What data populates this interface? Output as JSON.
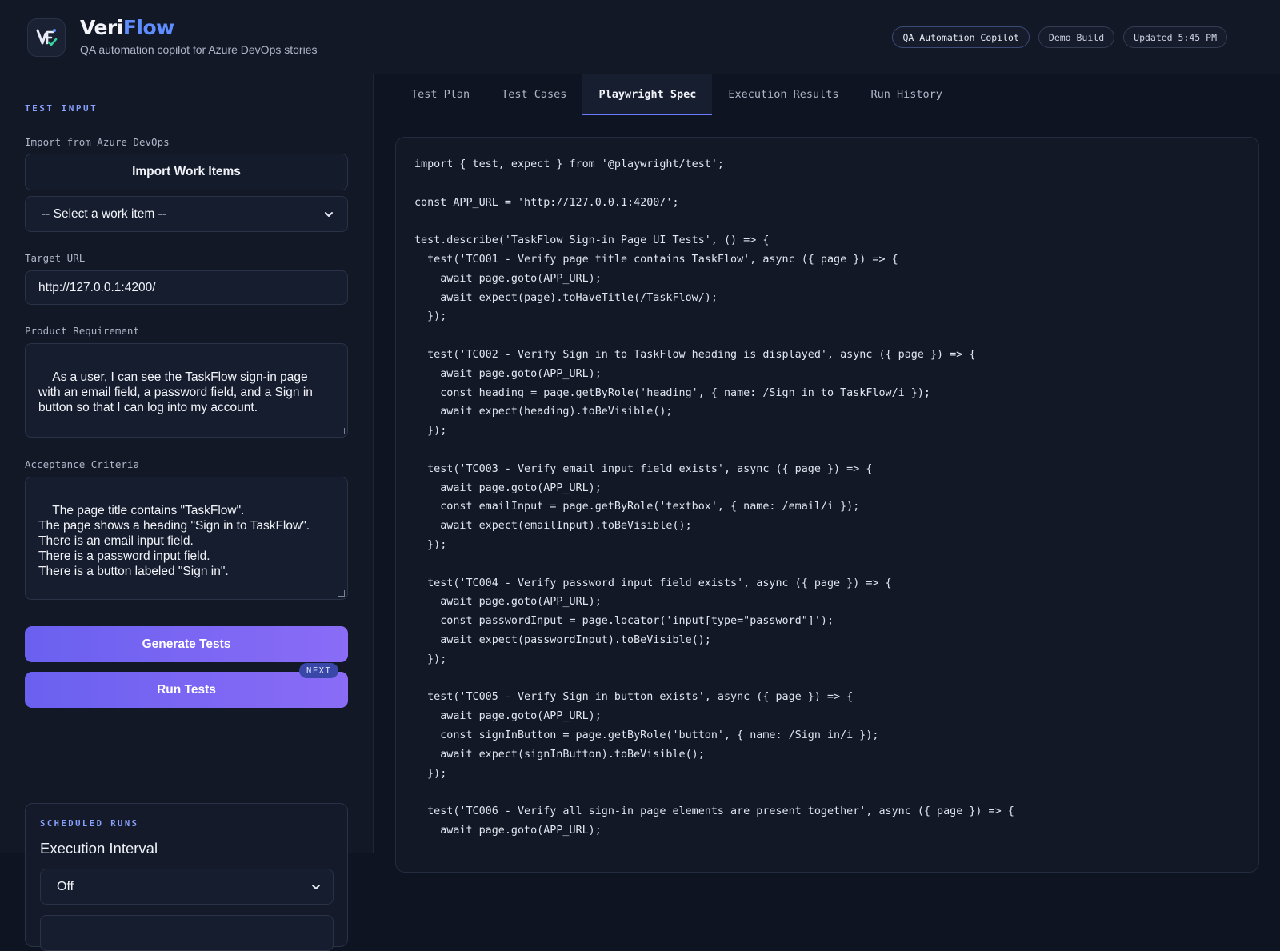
{
  "header": {
    "brand_prefix": "Veri",
    "brand_suffix": "Flow",
    "subtitle": "QA automation copilot for Azure DevOps stories",
    "badges": [
      "QA Automation Copilot",
      "Demo Build",
      "Updated 5:45 PM"
    ]
  },
  "sidebar": {
    "section_title": "TEST INPUT",
    "import_label": "Import from Azure DevOps",
    "import_button": "Import Work Items",
    "work_item_select": "-- Select a work item --",
    "target_url_label": "Target URL",
    "target_url_value": "http://127.0.0.1:4200/",
    "requirement_label": "Product Requirement",
    "requirement_value": "As a user, I can see the TaskFlow sign-in page\nwith an email field, a password field, and a Sign in\nbutton so that I can log into my account.",
    "criteria_label": "Acceptance Criteria",
    "criteria_value": "The page title contains \"TaskFlow\".\nThe page shows a heading \"Sign in to TaskFlow\".\nThere is an email input field.\nThere is a password input field.\nThere is a button labeled \"Sign in\".",
    "generate_button": "Generate Tests",
    "run_button": "Run Tests",
    "next_badge": "NEXT",
    "scheduled": {
      "title": "SCHEDULED RUNS",
      "heading": "Execution Interval",
      "interval_value": "Off"
    }
  },
  "tabs": [
    "Test Plan",
    "Test Cases",
    "Playwright Spec",
    "Execution Results",
    "Run History"
  ],
  "active_tab": "Playwright Spec",
  "code_lines": [
    "import { test, expect } from '@playwright/test';",
    "",
    "const APP_URL = 'http://127.0.0.1:4200/';",
    "",
    "test.describe('TaskFlow Sign-in Page UI Tests', () => {",
    "  test('TC001 - Verify page title contains TaskFlow', async ({ page }) => {",
    "    await page.goto(APP_URL);",
    "    await expect(page).toHaveTitle(/TaskFlow/);",
    "  });",
    "",
    "  test('TC002 - Verify Sign in to TaskFlow heading is displayed', async ({ page }) => {",
    "    await page.goto(APP_URL);",
    "    const heading = page.getByRole('heading', { name: /Sign in to TaskFlow/i });",
    "    await expect(heading).toBeVisible();",
    "  });",
    "",
    "  test('TC003 - Verify email input field exists', async ({ page }) => {",
    "    await page.goto(APP_URL);",
    "    const emailInput = page.getByRole('textbox', { name: /email/i });",
    "    await expect(emailInput).toBeVisible();",
    "  });",
    "",
    "  test('TC004 - Verify password input field exists', async ({ page }) => {",
    "    await page.goto(APP_URL);",
    "    const passwordInput = page.locator('input[type=\"password\"]');",
    "    await expect(passwordInput).toBeVisible();",
    "  });",
    "",
    "  test('TC005 - Verify Sign in button exists', async ({ page }) => {",
    "    await page.goto(APP_URL);",
    "    const signInButton = page.getByRole('button', { name: /Sign in/i });",
    "    await expect(signInButton).toBeVisible();",
    "  });",
    "",
    "  test('TC006 - Verify all sign-in page elements are present together', async ({ page }) => {",
    "    await page.goto(APP_URL);"
  ],
  "colors": {
    "accent": "#6a7bff",
    "brand_blue": "#5f8dff",
    "button_gradient_start": "#6a60f0",
    "button_gradient_end": "#8a6cf6",
    "background": "#0f1422"
  }
}
